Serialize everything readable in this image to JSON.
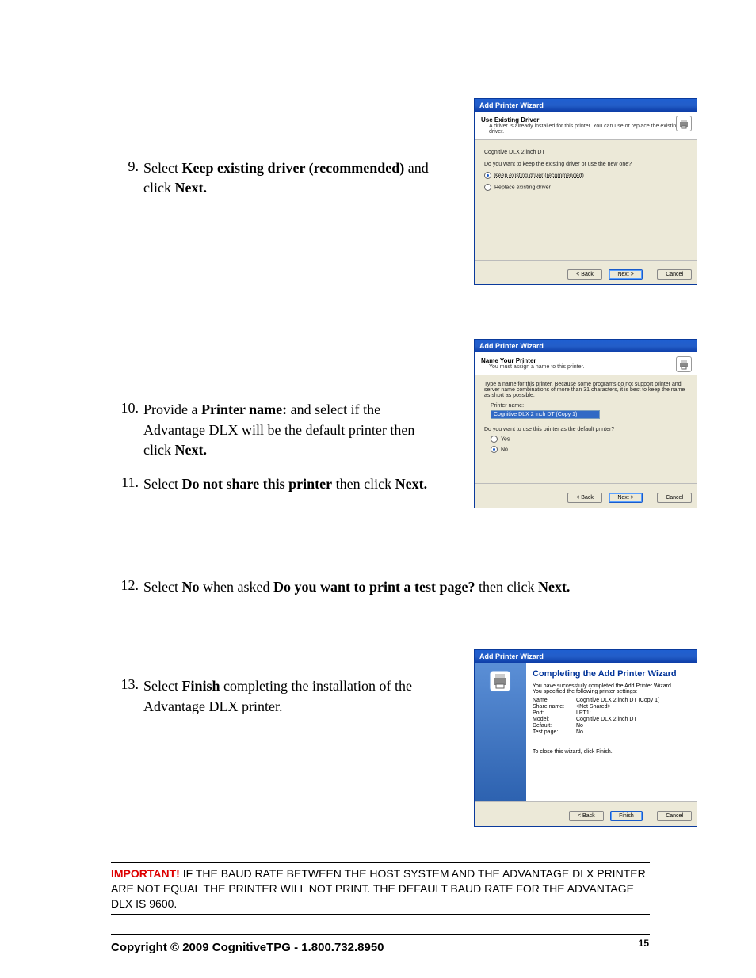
{
  "steps": {
    "s9": {
      "num": "9.",
      "pre": "Select ",
      "b1": "Keep existing driver (recommended)",
      "mid": " and click ",
      "b2": "Next."
    },
    "s10": {
      "num": "10.",
      "pre": "Provide a ",
      "b1": "Printer name:",
      "mid": " and select if the Advantage DLX will be the default printer then click ",
      "b2": "Next."
    },
    "s11": {
      "num": "11.",
      "pre": "Select ",
      "b1": "Do not share this printer",
      "mid": " then click ",
      "b2": "Next."
    },
    "s12": {
      "num": "12.",
      "pre": "Select ",
      "b1": "No",
      "mid": " when asked ",
      "b2": "Do you want to print a test page?",
      "post": " then click ",
      "b3": "Next."
    },
    "s13": {
      "num": "13.",
      "pre": "Select ",
      "b1": "Finish",
      "mid": " completing the installation of the Advantage DLX printer."
    }
  },
  "dlg1": {
    "title": "Add Printer Wizard",
    "ht": "Use Existing Driver",
    "hs": "A driver is already installed for this printer. You can use or replace the existing driver.",
    "model": "Cognitive DLX 2 inch DT",
    "q": "Do you want to keep the existing driver or use the new one?",
    "opt1": "Keep existing driver (recommended)",
    "opt2": "Replace existing driver",
    "back": "< Back",
    "next": "Next >",
    "cancel": "Cancel"
  },
  "dlg2": {
    "title": "Add Printer Wizard",
    "ht": "Name Your Printer",
    "hs": "You must assign a name to this printer.",
    "desc": "Type a name for this printer. Because some programs do not support printer and server name combinations of more than 31 characters, it is best to keep the name as short as possible.",
    "label": "Printer name:",
    "value": "Cognitive DLX 2 inch DT (Copy 1)",
    "q": "Do you want to use this printer as the default printer?",
    "yes": "Yes",
    "no": "No",
    "back": "< Back",
    "next": "Next >",
    "cancel": "Cancel"
  },
  "dlg3": {
    "title": "Add Printer Wizard",
    "h": "Completing the Add Printer Wizard",
    "line1": "You have successfully completed the Add Printer Wizard.",
    "line2": "You specified the following printer settings:",
    "rows": [
      {
        "k": "Name:",
        "v": "Cognitive DLX 2 inch DT (Copy 1)"
      },
      {
        "k": "Share name:",
        "v": "<Not Shared>"
      },
      {
        "k": "Port:",
        "v": "LPT1:"
      },
      {
        "k": "Model:",
        "v": "Cognitive DLX 2 inch DT"
      },
      {
        "k": "Default:",
        "v": "No"
      },
      {
        "k": "Test page:",
        "v": "No"
      }
    ],
    "close": "To close this wizard, click Finish.",
    "back": "< Back",
    "finish": "Finish",
    "cancel": "Cancel"
  },
  "important": {
    "label": "IMPORTANT!",
    "text": " IF THE BAUD RATE BETWEEN THE HOST SYSTEM AND THE ADVANTAGE DLX PRINTER ARE NOT EQUAL THE PRINTER WILL NOT PRINT.  THE DEFAULT BAUD RATE FOR THE ADVANTAGE DLX IS 9600."
  },
  "footer": {
    "copy": "Copyright © 2009 CognitiveTPG - 1.800.732.8950",
    "page": "15"
  }
}
